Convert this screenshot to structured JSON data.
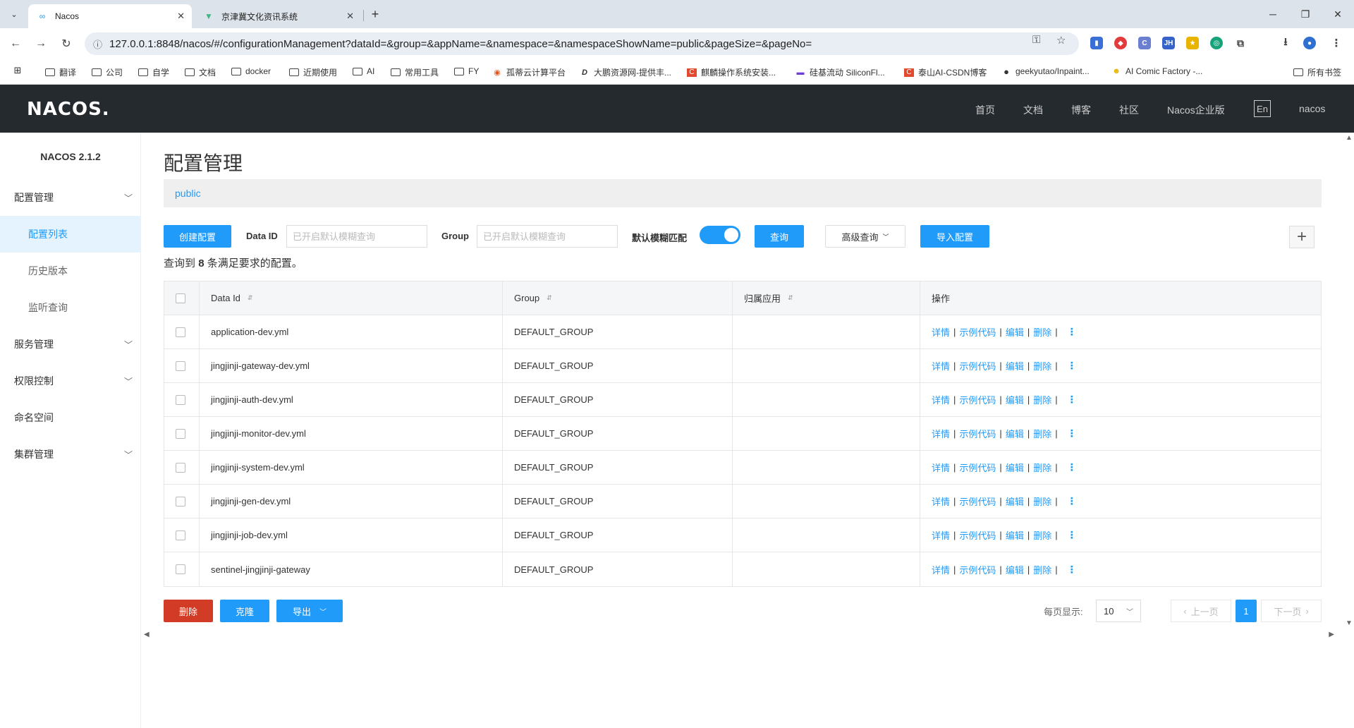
{
  "browser": {
    "tabs": [
      {
        "title": "Nacos",
        "icon": "infinity-icon"
      },
      {
        "title": "京津冀文化资讯系统",
        "icon": "vue-icon"
      }
    ],
    "url": "127.0.0.1:8848/nacos/#/configurationManagement?dataId=&group=&appName=&namespace=&namespaceShowName=public&pageSize=&pageNo=",
    "bookmarks": [
      {
        "label": "翻译",
        "type": "folder"
      },
      {
        "label": "公司",
        "type": "folder"
      },
      {
        "label": "自学",
        "type": "folder"
      },
      {
        "label": "文档",
        "type": "folder"
      },
      {
        "label": "docker",
        "type": "folder"
      },
      {
        "label": "近期使用",
        "type": "folder"
      },
      {
        "label": "AI",
        "type": "folder"
      },
      {
        "label": "常用工具",
        "type": "folder"
      },
      {
        "label": "FY",
        "type": "folder"
      },
      {
        "label": "孤蒂云计算平台",
        "type": "link"
      },
      {
        "label": "大鹏资源网-提供丰...",
        "type": "link"
      },
      {
        "label": "麒麟操作系统安装...",
        "type": "link"
      },
      {
        "label": "硅基流动 SiliconFl...",
        "type": "link"
      },
      {
        "label": "泰山AI-CSDN博客",
        "type": "link"
      },
      {
        "label": "geekyutao/Inpaint...",
        "type": "link"
      },
      {
        "label": "AI Comic Factory -...",
        "type": "link"
      }
    ],
    "all_bookmarks": "所有书签"
  },
  "header": {
    "logo": "NACOS.",
    "nav": [
      "首页",
      "文档",
      "博客",
      "社区",
      "Nacos企业版"
    ],
    "lang": "En",
    "user": "nacos"
  },
  "sidebar": {
    "version": "NACOS 2.1.2",
    "items": [
      {
        "label": "配置管理",
        "expandable": true
      },
      {
        "label": "配置列表",
        "sub": true,
        "active": true
      },
      {
        "label": "历史版本",
        "sub": true
      },
      {
        "label": "监听查询",
        "sub": true
      },
      {
        "label": "服务管理",
        "expandable": true
      },
      {
        "label": "权限控制",
        "expandable": true
      },
      {
        "label": "命名空间",
        "expandable": false
      },
      {
        "label": "集群管理",
        "expandable": true
      }
    ]
  },
  "main": {
    "title": "配置管理",
    "namespace": "public",
    "create_btn": "创建配置",
    "dataid_label": "Data ID",
    "dataid_placeholder": "已开启默认模糊查询",
    "group_label": "Group",
    "group_placeholder": "已开启默认模糊查询",
    "fuzzy_label": "默认模糊匹配",
    "fuzzy_on": true,
    "query_btn": "查询",
    "advanced_btn": "高级查询",
    "import_btn": "导入配置",
    "result_prefix": "查询到",
    "result_count": "8",
    "result_suffix": "条满足要求的配置。"
  },
  "table": {
    "headers": [
      "Data Id",
      "Group",
      "归属应用",
      "操作"
    ],
    "rows": [
      {
        "data_id": "application-dev.yml",
        "group": "DEFAULT_GROUP",
        "app": ""
      },
      {
        "data_id": "jingjinji-gateway-dev.yml",
        "group": "DEFAULT_GROUP",
        "app": ""
      },
      {
        "data_id": "jingjinji-auth-dev.yml",
        "group": "DEFAULT_GROUP",
        "app": ""
      },
      {
        "data_id": "jingjinji-monitor-dev.yml",
        "group": "DEFAULT_GROUP",
        "app": ""
      },
      {
        "data_id": "jingjinji-system-dev.yml",
        "group": "DEFAULT_GROUP",
        "app": ""
      },
      {
        "data_id": "jingjinji-gen-dev.yml",
        "group": "DEFAULT_GROUP",
        "app": ""
      },
      {
        "data_id": "jingjinji-job-dev.yml",
        "group": "DEFAULT_GROUP",
        "app": ""
      },
      {
        "data_id": "sentinel-jingjinji-gateway",
        "group": "DEFAULT_GROUP",
        "app": ""
      }
    ],
    "ops": [
      "详情",
      "示例代码",
      "编辑",
      "删除"
    ]
  },
  "footer": {
    "delete_btn": "删除",
    "clone_btn": "克隆",
    "export_btn": "导出",
    "per_page_label": "每页显示:",
    "per_page": "10",
    "prev": "上一页",
    "next": "下一页",
    "current_page": "1"
  }
}
